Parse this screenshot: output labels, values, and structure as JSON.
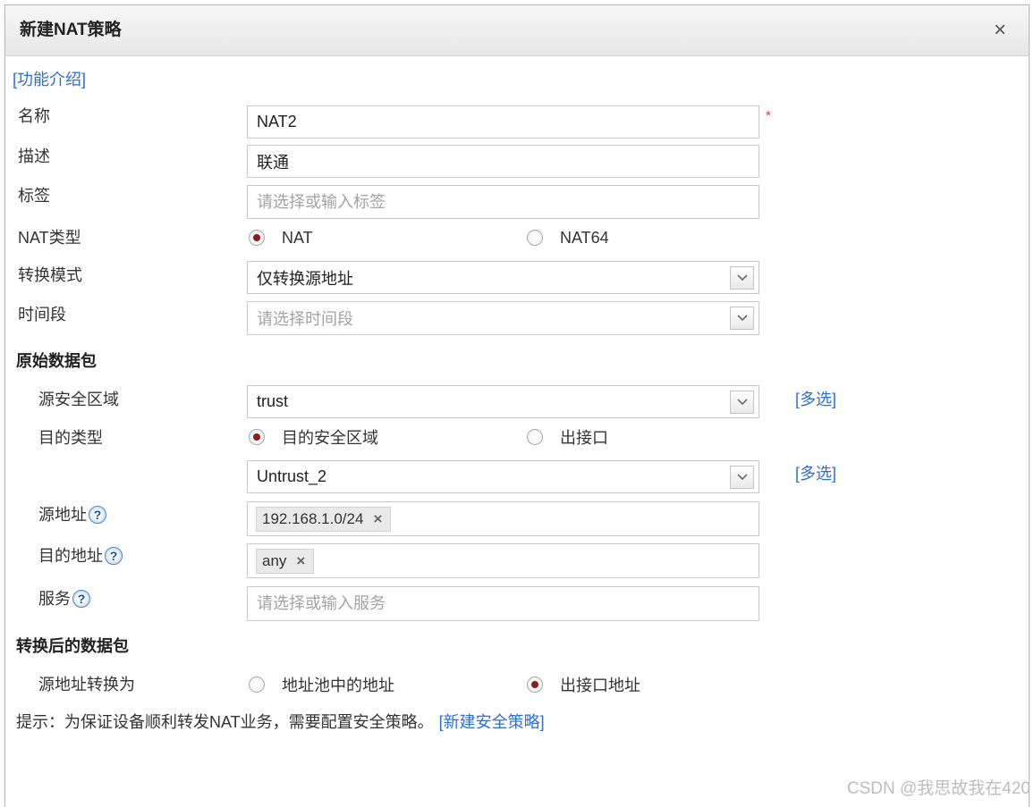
{
  "dialog": {
    "title": "新建NAT策略",
    "close_glyph": "×",
    "intro_link": "[功能介绍]"
  },
  "form": {
    "name": {
      "label": "名称",
      "value": "NAT2",
      "required_mark": "*"
    },
    "description": {
      "label": "描述",
      "value": "联通"
    },
    "tags": {
      "label": "标签",
      "placeholder": "请选择或输入标签"
    },
    "nat_type": {
      "label": "NAT类型",
      "options": [
        {
          "label": "NAT",
          "checked": true
        },
        {
          "label": "NAT64",
          "checked": false
        }
      ]
    },
    "conversion_mode": {
      "label": "转换模式",
      "value": "仅转换源地址"
    },
    "time_range": {
      "label": "时间段",
      "placeholder": "请选择时间段"
    }
  },
  "original_packet": {
    "heading": "原始数据包",
    "source_zone": {
      "label": "源安全区域",
      "value": "trust",
      "multi_link": "[多选]"
    },
    "dest_type": {
      "label": "目的类型",
      "options": [
        {
          "label": "目的安全区域",
          "checked": true
        },
        {
          "label": "出接口",
          "checked": false
        }
      ]
    },
    "dest_zone": {
      "value": "Untrust_2",
      "multi_link": "[多选]"
    },
    "source_address": {
      "label": "源地址",
      "help_glyph": "?",
      "tags": [
        "192.168.1.0/24"
      ],
      "remove_glyph": "×"
    },
    "dest_address": {
      "label": "目的地址",
      "help_glyph": "?",
      "tags": [
        "any"
      ],
      "remove_glyph": "×"
    },
    "service": {
      "label": "服务",
      "help_glyph": "?",
      "placeholder": "请选择或输入服务"
    }
  },
  "translated_packet": {
    "heading": "转换后的数据包",
    "source_translate": {
      "label": "源地址转换为",
      "options": [
        {
          "label": "地址池中的地址",
          "checked": false
        },
        {
          "label": "出接口地址",
          "checked": true
        }
      ]
    }
  },
  "hint": {
    "text": "提示：为保证设备顺利转发NAT业务，需要配置安全策略。",
    "link": "[新建安全策略]"
  },
  "watermark": "CSDN @我思故我在420",
  "icons": {
    "close": "close-icon",
    "dropdown": "chevron-down-icon",
    "help": "help-icon",
    "tag_remove": "remove-tag-icon",
    "radio": "radio-button"
  },
  "colors": {
    "link": "#2f6fd0",
    "required": "#e23b3b",
    "radio_checked": "#8e1b1b",
    "header_bg": "#eeeeee",
    "watermark": "#bdbdbd"
  }
}
